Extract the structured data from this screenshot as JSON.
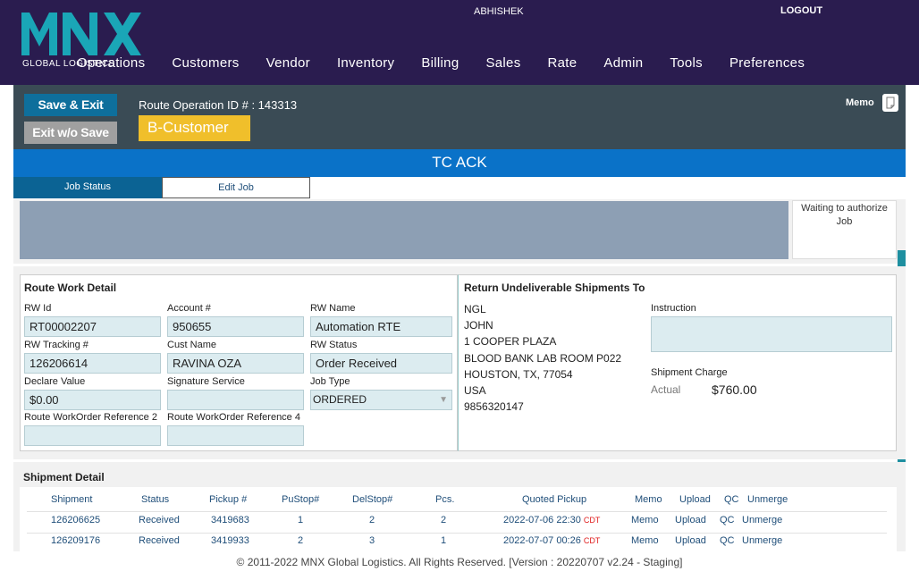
{
  "app": {
    "logo_text": "MNX",
    "logo_sub": "GLOBAL LOGISTICS",
    "user": "ABHISHEK",
    "logout": "LOGOUT",
    "menu": [
      "Operations",
      "Customers",
      "Vendor",
      "Inventory",
      "Billing",
      "Sales",
      "Rate",
      "Admin",
      "Tools",
      "Preferences"
    ]
  },
  "header": {
    "save_exit": "Save & Exit",
    "exit_no_save": "Exit w/o Save",
    "route_id_label": "Route Operation ID # : 143313",
    "customer_badge": "B-Customer",
    "memo_label": "Memo",
    "banner": "TC ACK"
  },
  "tabs": [
    "Job Status",
    "Edit Job"
  ],
  "status": {
    "message": "Waiting to authorize Job"
  },
  "route_work_detail": {
    "title": "Route Work Detail",
    "rw_id_label": "RW Id",
    "rw_id": "RT00002207",
    "account_label": "Account #",
    "account": "950655",
    "rw_name_label": "RW Name",
    "rw_name": "Automation RTE",
    "rw_tracking_label": "RW Tracking #",
    "rw_tracking": "126206614",
    "cust_name_label": "Cust Name",
    "cust_name": "RAVINA OZA",
    "rw_status_label": "RW Status",
    "rw_status": "Order Received",
    "declare_label": "Declare Value",
    "declare": "$0.00",
    "signature_label": "Signature Service",
    "signature": "",
    "job_type_label": "Job Type",
    "job_type": "ORDERED",
    "ref2_label": "Route WorkOrder Reference 2",
    "ref2": "",
    "ref4_label": "Route WorkOrder Reference 4",
    "ref4": ""
  },
  "return_to": {
    "title": "Return Undeliverable Shipments To",
    "lines": [
      "NGL",
      "JOHN",
      "1 COOPER PLAZA",
      "BLOOD BANK LAB ROOM P022",
      "HOUSTON, TX, 77054",
      "USA",
      "9856320147"
    ],
    "instruction_label": "Instruction",
    "instruction": "",
    "charge_label": "Shipment Charge",
    "actual_label": "Actual",
    "actual": "$760.00"
  },
  "shipment_detail": {
    "title": "Shipment Detail",
    "headers": [
      "Shipment",
      "Status",
      "Pickup #",
      "PuStop#",
      "DelStop#",
      "Pcs.",
      "Quoted Pickup",
      "Memo",
      "Upload",
      "QC",
      "Unmerge"
    ],
    "rows": [
      {
        "shipment": "126206625",
        "status": "Received",
        "pickup": "3419683",
        "pustop": "1",
        "delstop": "2",
        "pcs": "2",
        "quoted": "2022-07-06 22:30",
        "tz": "CDT",
        "memo": "Memo",
        "upload": "Upload",
        "qc": "QC",
        "unmerge": "Unmerge"
      },
      {
        "shipment": "126209176",
        "status": "Received",
        "pickup": "3419933",
        "pustop": "2",
        "delstop": "3",
        "pcs": "1",
        "quoted": "2022-07-07 00:26",
        "tz": "CDT",
        "memo": "Memo",
        "upload": "Upload",
        "qc": "QC",
        "unmerge": "Unmerge"
      }
    ]
  },
  "footer": "© 2011-2022 MNX Global Logistics. All Rights Reserved. [Version : 20220707 v2.24 - Staging]",
  "colors": {
    "nav_bg": "#2a1c4f",
    "logo": "#1aa6b7",
    "header_bg": "#3a4b55",
    "banner": "#0a72c8",
    "badge": "#f0bf2b",
    "link": "#1f4e79"
  }
}
